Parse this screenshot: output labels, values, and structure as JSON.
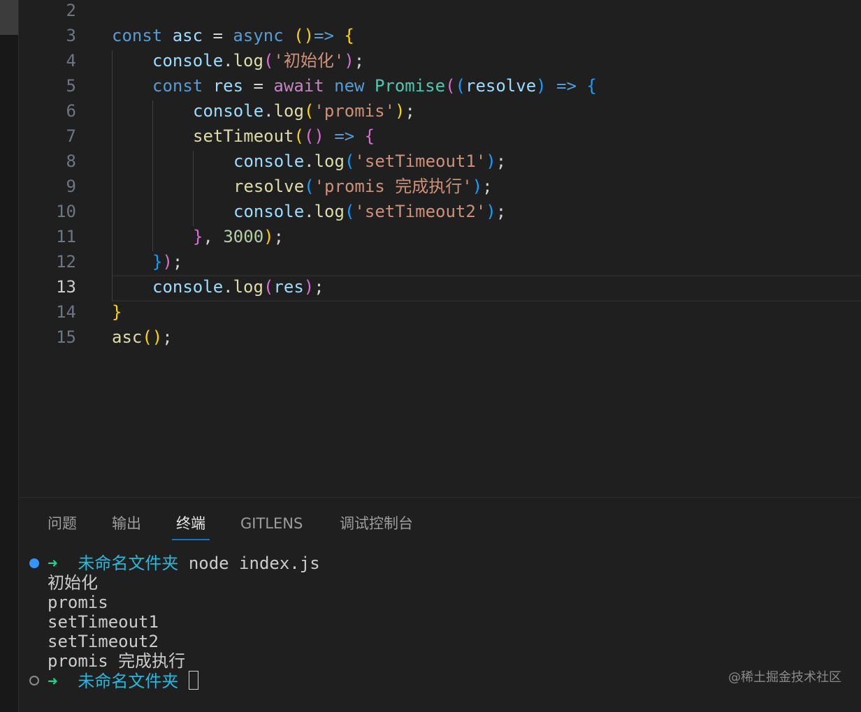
{
  "editor": {
    "current_line": "13",
    "lines": [
      {
        "num": "2",
        "tokens": []
      },
      {
        "num": "3",
        "tokens": [
          "const",
          "asc",
          "=",
          "async",
          "()",
          "=>",
          "{"
        ]
      },
      {
        "num": "4",
        "tokens": [
          "console",
          ".",
          "log",
          "(",
          "'初始化'",
          ")",
          ";"
        ]
      },
      {
        "num": "5",
        "tokens": [
          "const",
          "res",
          "=",
          "await",
          "new",
          "Promise",
          "(",
          "(",
          "resolve",
          ")",
          "=>",
          "{"
        ]
      },
      {
        "num": "6",
        "tokens": [
          "console",
          ".",
          "log",
          "(",
          "'promis'",
          ")",
          ";"
        ]
      },
      {
        "num": "7",
        "tokens": [
          "setTimeout",
          "(",
          "()",
          "=>",
          "{"
        ]
      },
      {
        "num": "8",
        "tokens": [
          "console",
          ".",
          "log",
          "(",
          "'setTimeout1'",
          ")",
          ";"
        ]
      },
      {
        "num": "9",
        "tokens": [
          "resolve",
          "(",
          "'promis 完成执行'",
          ")",
          ";"
        ]
      },
      {
        "num": "10",
        "tokens": [
          "console",
          ".",
          "log",
          "(",
          "'setTimeout2'",
          ")",
          ";"
        ]
      },
      {
        "num": "11",
        "tokens": [
          "}",
          ",",
          "3000",
          ")",
          ";"
        ]
      },
      {
        "num": "12",
        "tokens": [
          "}",
          ")",
          ";"
        ]
      },
      {
        "num": "13",
        "tokens": [
          "console",
          ".",
          "log",
          "(",
          "res",
          ")",
          ";"
        ]
      },
      {
        "num": "14",
        "tokens": [
          "}"
        ]
      },
      {
        "num": "15",
        "tokens": [
          "asc",
          "()",
          ";"
        ]
      }
    ]
  },
  "panel": {
    "tabs": [
      {
        "label": "问题"
      },
      {
        "label": "输出"
      },
      {
        "label": "终端"
      },
      {
        "label": "GITLENS"
      },
      {
        "label": "调试控制台"
      }
    ],
    "active_tab": "终端"
  },
  "terminal": {
    "prompt_arrow": "➜",
    "cwd": "未命名文件夹",
    "command": "node index.js",
    "output": [
      "初始化",
      "promis",
      "setTimeout1",
      "setTimeout2",
      "promis 完成执行"
    ]
  },
  "watermark": "@稀土掘金技术社区",
  "colors": {
    "background": "#1f1f1f",
    "keyword": "#569cd6",
    "control": "#c586c0",
    "variable": "#9cdcfe",
    "function": "#dcdcaa",
    "string": "#ce9178",
    "number": "#b5cea8",
    "class": "#4ec9b0",
    "active_tab_underline": "#0078d4",
    "prompt_arrow": "#23d18b",
    "cwd": "#29b8db"
  }
}
